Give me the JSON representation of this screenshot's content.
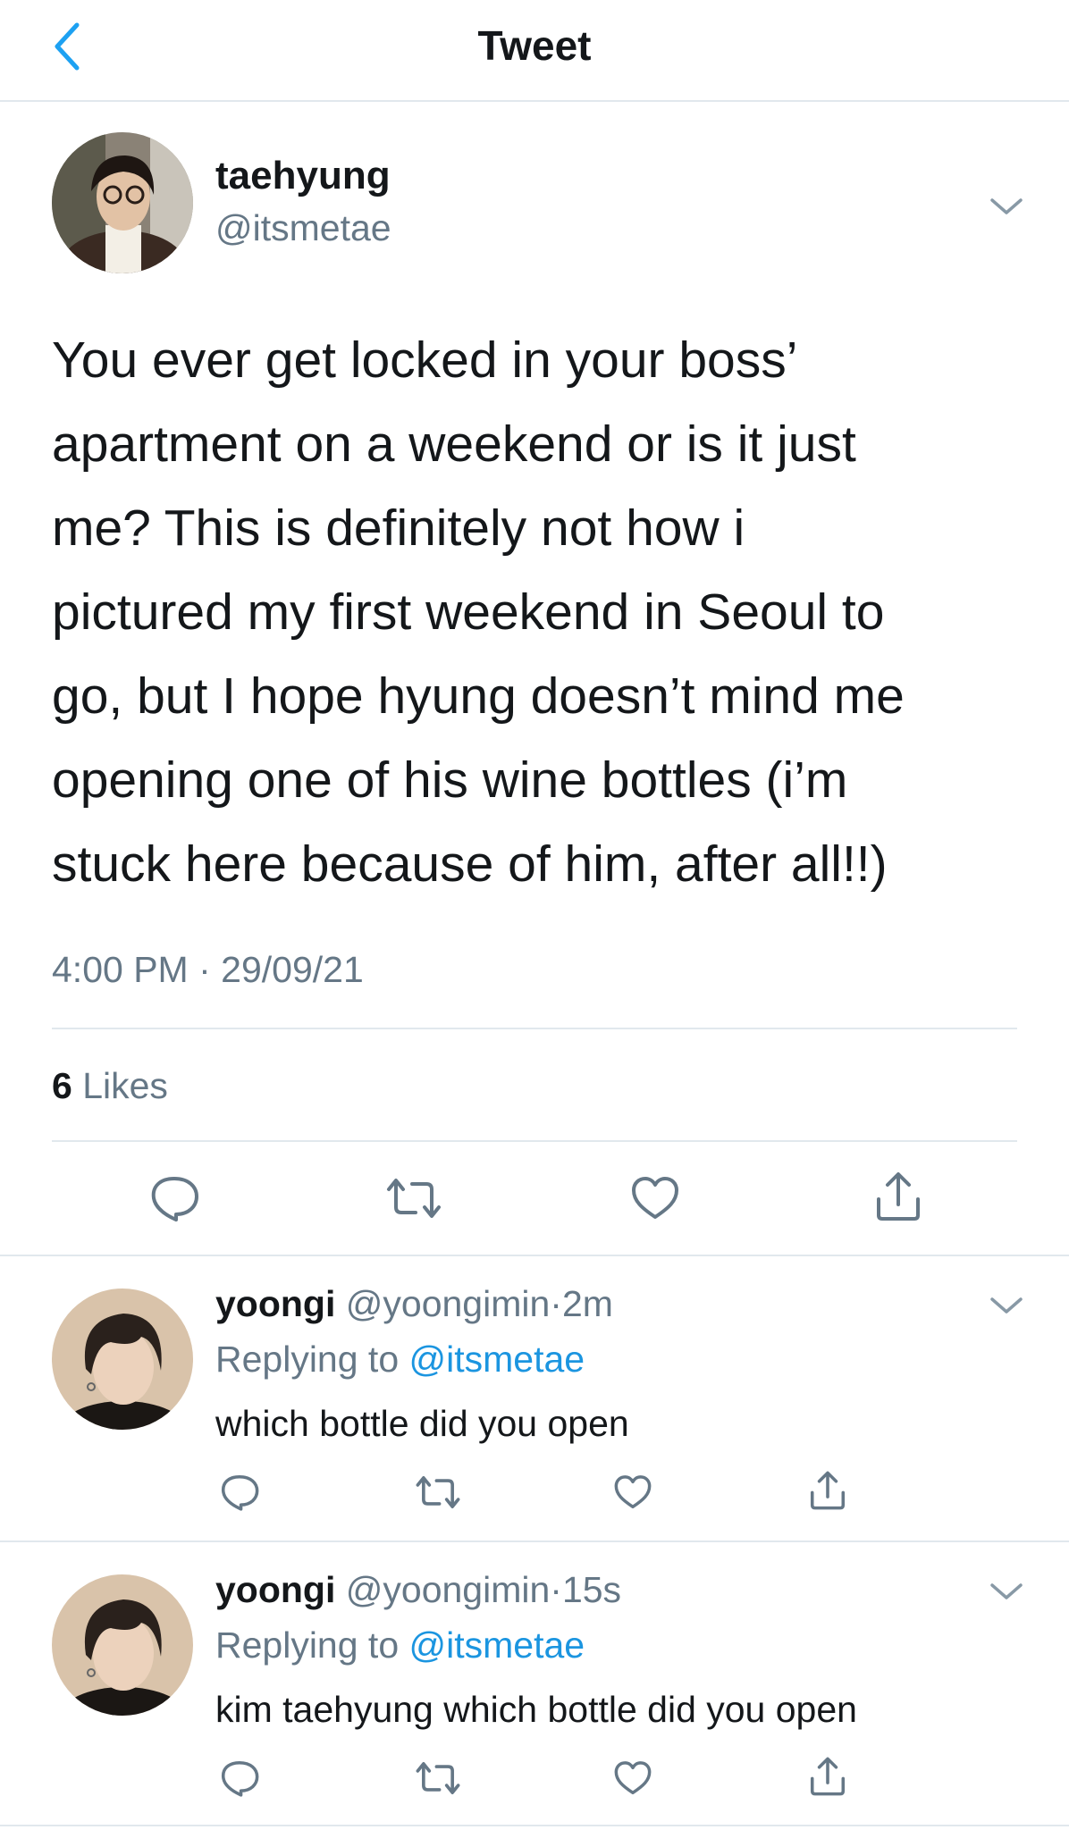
{
  "header": {
    "title": "Tweet",
    "back_icon": "chevron-left-icon"
  },
  "tweet": {
    "author_name": "taehyung",
    "author_handle": "@itsmetae",
    "text": "You ever get locked in your boss’\napartment on a weekend or is it just\nme? This is definitely not how i\npictured my first weekend in Seoul to\ngo, but I hope hyung doesn’t mind me\nopening one of his wine bottles (i’m\nstuck here because of him, after all!!)",
    "time": "4:00 PM",
    "separator": "·",
    "date": "29/09/21",
    "likes_count": "6",
    "likes_label": "Likes"
  },
  "replies": [
    {
      "name": "yoongi",
      "handle": "@yoongimin",
      "separator": "·",
      "time": "2m",
      "replying_label": "Replying to",
      "replying_to": "@itsmetae",
      "text": "which bottle did you open"
    },
    {
      "name": "yoongi",
      "handle": "@yoongimin",
      "separator": "·",
      "time": "15s",
      "replying_label": "Replying to",
      "replying_to": "@itsmetae",
      "text": "kim taehyung which bottle did you open"
    }
  ],
  "colors": {
    "accent_blue": "#1b95e0",
    "secondary_text": "#657786",
    "primary_text": "#14171a",
    "divider": "#e1e8ed"
  },
  "icons": [
    "reply-icon",
    "retweet-icon",
    "like-icon",
    "share-icon",
    "chevron-down-icon"
  ]
}
